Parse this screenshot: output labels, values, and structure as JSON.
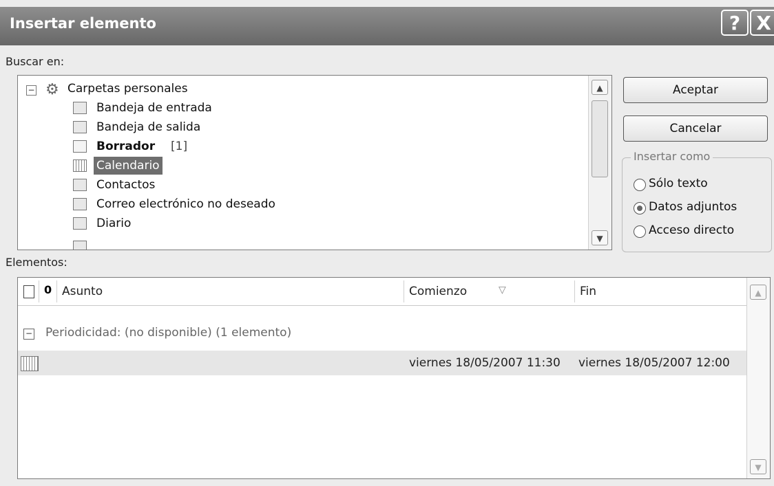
{
  "window": {
    "title": "Insertar elemento",
    "help_label": "?",
    "close_label": "X"
  },
  "search": {
    "label": "Buscar en:",
    "root": {
      "label": "Carpetas personales",
      "icon": "personal-folders-icon",
      "expander": "−"
    },
    "folders": [
      {
        "label": "Bandeja de entrada",
        "icon": "inbox-icon"
      },
      {
        "label": "Bandeja de salida",
        "icon": "outbox-icon"
      },
      {
        "label": "Borrador",
        "count": "[1]",
        "icon": "drafts-icon",
        "bold": true
      },
      {
        "label": "Calendario",
        "icon": "calendar-icon",
        "selected": true
      },
      {
        "label": "Contactos",
        "icon": "contacts-icon"
      },
      {
        "label": "Correo electrónico no deseado",
        "icon": "junk-mail-icon"
      },
      {
        "label": "Diario",
        "icon": "journal-icon"
      }
    ]
  },
  "buttons": {
    "ok": "Aceptar",
    "cancel": "Cancelar"
  },
  "insert_as": {
    "label": "Insertar como",
    "options": [
      {
        "label": "Sólo texto",
        "selected": false
      },
      {
        "label": "Datos adjuntos",
        "selected": true
      },
      {
        "label": "Acceso directo",
        "selected": false
      }
    ]
  },
  "items": {
    "label": "Elementos:",
    "columns": {
      "icon": "document-icon",
      "attachment": "paperclip-icon",
      "subject": "Asunto",
      "start": "Comienzo",
      "end": "Fin"
    },
    "group": {
      "expander": "−",
      "label": "Periodicidad: (no disponible) (1 elemento)"
    },
    "rows": [
      {
        "icon": "calendar-icon",
        "subject": "",
        "start": "viernes 18/05/2007 11:30",
        "end": "viernes 18/05/2007 12:00"
      }
    ]
  },
  "colors": {
    "titlebar": "#7a7a7a",
    "selection": "#6e6e6e",
    "row_highlight": "#e6e6e6"
  }
}
